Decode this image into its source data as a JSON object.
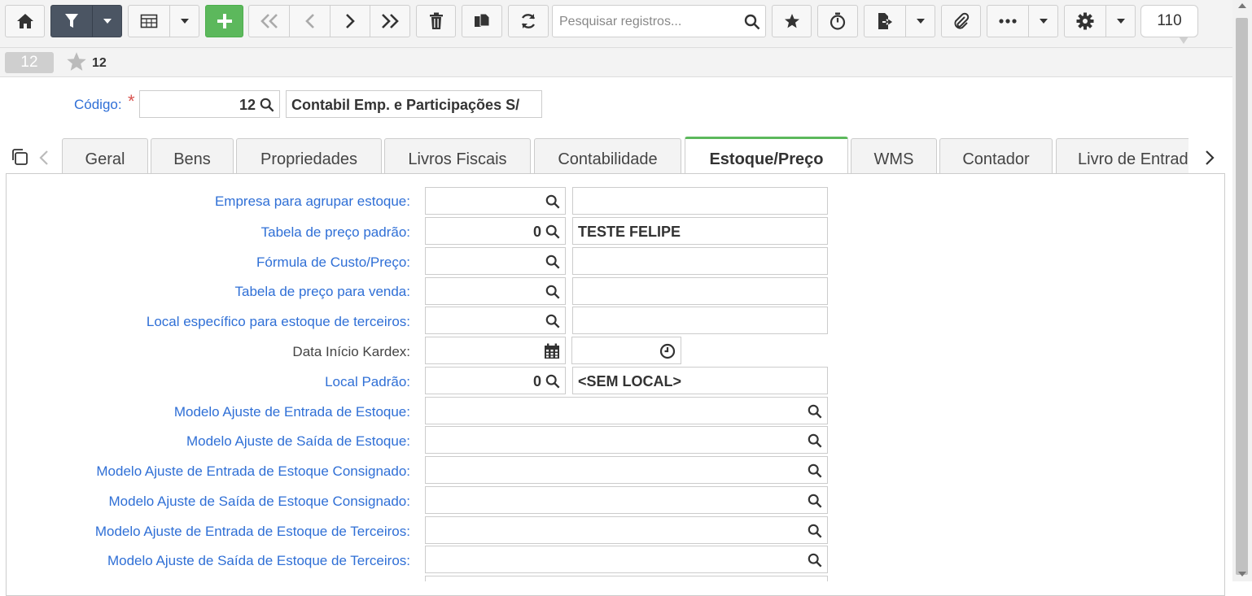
{
  "toolbar": {
    "home": "home-icon",
    "filter": "filter-icon",
    "grid": "table-icon",
    "add": "plus-icon",
    "nav": [
      "first-icon",
      "prev-icon",
      "next-icon",
      "last-icon"
    ],
    "search_placeholder": "Pesquisar registros...",
    "page_number": "110"
  },
  "record": {
    "badge": "12",
    "favorite_id": "12"
  },
  "header": {
    "codigo_label": "Código:",
    "required_mark": "*",
    "codigo_value": "12",
    "codigo_desc": "Contabil Emp. e Participações S/"
  },
  "tabs": [
    {
      "label": "Geral"
    },
    {
      "label": "Bens"
    },
    {
      "label": "Propriedades"
    },
    {
      "label": "Livros Fiscais"
    },
    {
      "label": "Contabilidade"
    },
    {
      "label": "Estoque/Preço"
    },
    {
      "label": "WMS"
    },
    {
      "label": "Contador"
    },
    {
      "label": "Livro de Entrad"
    }
  ],
  "active_tab": "Estoque/Preço",
  "form": {
    "fields": [
      {
        "label": "Empresa para agrupar estoque:",
        "code": "",
        "desc": ""
      },
      {
        "label": "Tabela de preço padrão:",
        "code": "0",
        "desc": "TESTE FELIPE"
      },
      {
        "label": "Fórmula de Custo/Preço:",
        "code": "",
        "desc": ""
      },
      {
        "label": "Tabela de preço para venda:",
        "code": "",
        "desc": ""
      },
      {
        "label": "Local específico para estoque de terceiros:",
        "code": "",
        "desc": ""
      },
      {
        "label": "Data Início Kardex:",
        "date": "",
        "time": ""
      },
      {
        "label": "Local Padrão:",
        "code": "0",
        "desc": "<SEM LOCAL>"
      },
      {
        "label": "Modelo Ajuste de Entrada de Estoque:",
        "value": ""
      },
      {
        "label": "Modelo Ajuste de Saída de Estoque:",
        "value": ""
      },
      {
        "label": "Modelo Ajuste de Entrada de Estoque Consignado:",
        "value": ""
      },
      {
        "label": "Modelo Ajuste de Saída de Estoque Consignado:",
        "value": ""
      },
      {
        "label": "Modelo Ajuste de Entrada de Estoque de Terceiros:",
        "value": ""
      },
      {
        "label": "Modelo Ajuste de Saída de Estoque de Terceiros:",
        "value": ""
      }
    ]
  },
  "colors": {
    "label_blue": "#2f6fd6",
    "active_tab_accent": "#5cb85c",
    "add_button": "#5cb85c",
    "filter_button": "#4b5563"
  }
}
